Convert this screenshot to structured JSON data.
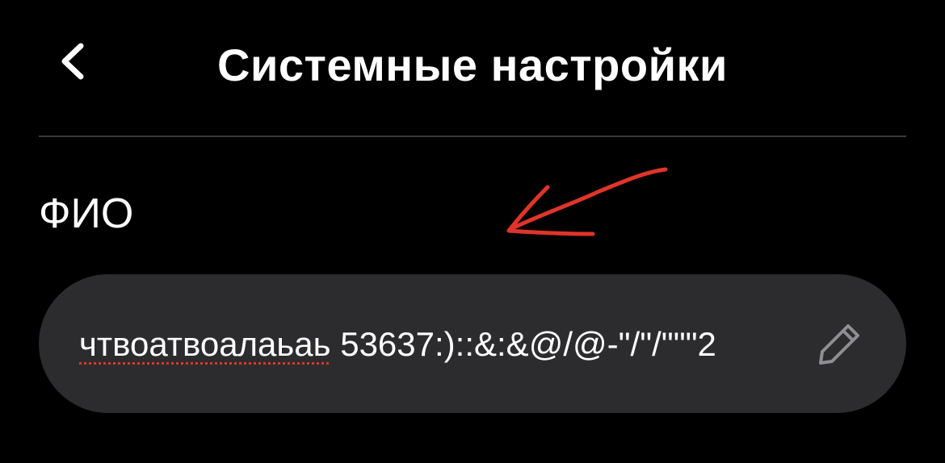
{
  "header": {
    "back_icon": "chevron-left-icon",
    "title": "Системные настройки"
  },
  "form": {
    "field_label": "ФИО",
    "name_value_misspelled": "чтвоатвоалаьаь",
    "name_value_rest": " 53637:)::&:&@/@-\"/\"/\"\"\"2",
    "edit_icon": "pencil-icon"
  },
  "annotation": {
    "icon": "arrow-icon",
    "color": "#e0342a"
  },
  "colors": {
    "background": "#000000",
    "input_background": "#2c2c2e",
    "divider": "#3a3a3c",
    "text": "#ffffff",
    "spellcheck_underline": "#e0342a",
    "edit_icon": "#8e8e93"
  }
}
